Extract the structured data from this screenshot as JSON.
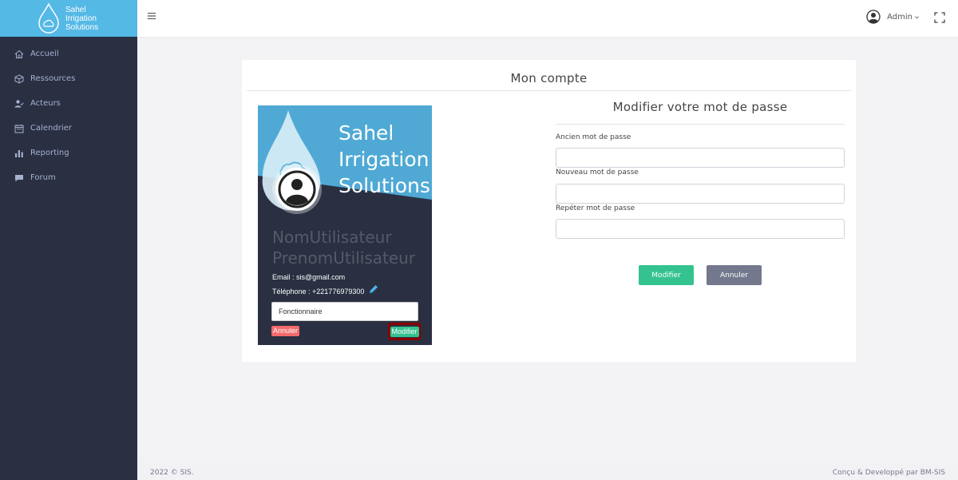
{
  "brand": {
    "line1": "Sahel",
    "line2": "Irrigation",
    "line3": "Solutions"
  },
  "sidebar": {
    "items": [
      {
        "label": "Accueil",
        "icon": "home-icon"
      },
      {
        "label": "Ressources",
        "icon": "box-icon"
      },
      {
        "label": "Acteurs",
        "icon": "user-check-icon"
      },
      {
        "label": "Calendrier",
        "icon": "calendar-icon"
      },
      {
        "label": "Reporting",
        "icon": "bar-chart-icon"
      },
      {
        "label": "Forum",
        "icon": "chat-icon"
      }
    ]
  },
  "topbar": {
    "user": "Admin"
  },
  "page": {
    "title": "Mon compte"
  },
  "profile": {
    "brand_line1": "Sahel",
    "brand_line2": "Irrigation",
    "brand_line3": "Solutions",
    "name": "NomUtilisateur",
    "surname": "PrenomUtilisateur",
    "email": "Email : sis@gmail.com",
    "phone": "Téléphone : +221776979300",
    "role_value": "Fonctionnaire",
    "cancel_label": "Annuler",
    "modify_label": "Modifier"
  },
  "password_form": {
    "title": "Modifier votre mot de passe",
    "old_label": "Ancien mot de passe",
    "new_label": "Nouveau mot de passe",
    "repeat_label": "Repéter mot de passe",
    "submit_label": "Modifier",
    "cancel_label": "Annuler"
  },
  "footer": {
    "left": "2022 © SIS.",
    "right": "Conçu & Developpé par BM-SIS"
  },
  "colors": {
    "sidebar_bg": "#2a3042",
    "brand_bg": "#55b9e6",
    "success": "#34c38f",
    "danger": "#f46a6a",
    "secondary": "#74788d",
    "highlight_border": "#8b0000"
  }
}
